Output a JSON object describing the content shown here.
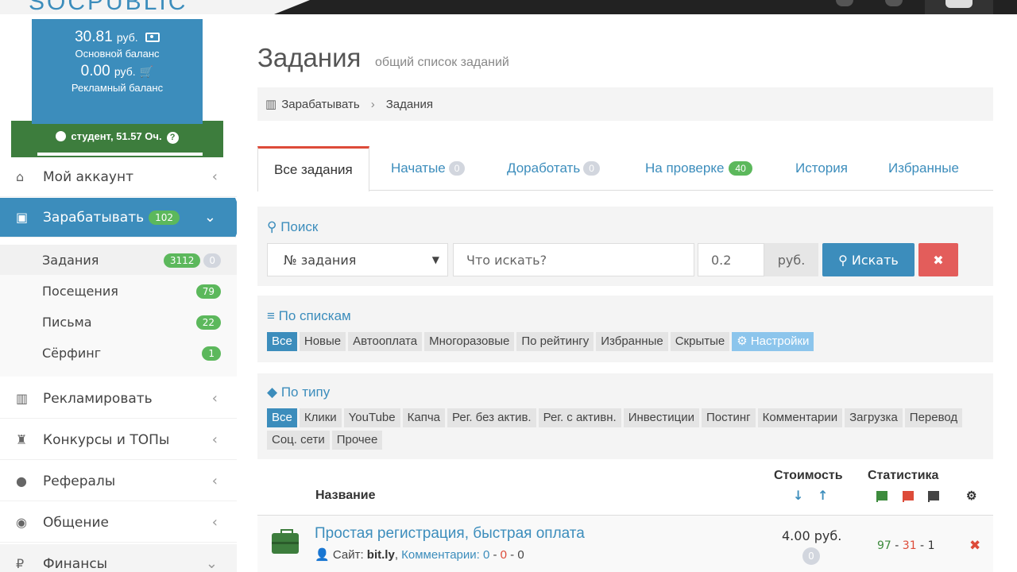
{
  "header": {
    "logo": "SOCPUBLIC"
  },
  "sidebar": {
    "balance_main": "30.81",
    "balance_main_unit": "руб.",
    "balance_main_label": "Основной баланс",
    "balance_ad": "0.00",
    "balance_ad_unit": "руб.",
    "balance_ad_label": "Рекламный баланс",
    "level": "студент, 51.57 Оч.",
    "menu": {
      "account": "Мой аккаунт",
      "earn": "Зарабатывать",
      "earn_badge": "102",
      "advertise": "Рекламировать",
      "contests": "Конкурсы и ТОПы",
      "referrals": "Рефералы",
      "chat": "Общение",
      "finance": "Финансы"
    },
    "submenu": [
      {
        "label": "Задания",
        "badge": "3112",
        "badge2": "0"
      },
      {
        "label": "Посещения",
        "badge": "79"
      },
      {
        "label": "Письма",
        "badge": "22"
      },
      {
        "label": "Сёрфинг",
        "badge": "1"
      }
    ]
  },
  "page": {
    "title": "Задания",
    "subtitle": "общий список заданий"
  },
  "breadcrumb": {
    "root": "Зарабатывать",
    "current": "Задания"
  },
  "tabs": {
    "all": "Все задания",
    "started": "Начатые",
    "started_count": "0",
    "rework": "Доработать",
    "rework_count": "0",
    "review": "На проверке",
    "review_count": "40",
    "history": "История",
    "favorites": "Избранные"
  },
  "search": {
    "title": "Поиск",
    "select_value": "№ задания",
    "placeholder": "Что искать?",
    "price_value": "0.2",
    "price_unit": "руб.",
    "button": "Искать",
    "clear": "✖"
  },
  "lists": {
    "title": "По спискам",
    "chips": [
      "Все",
      "Новые",
      "Автооплата",
      "Многоразовые",
      "По рейтингу",
      "Избранные",
      "Скрытые",
      "Настройки"
    ]
  },
  "types": {
    "title": "По типу",
    "chips": [
      "Все",
      "Клики",
      "YouTube",
      "Капча",
      "Рег. без актив.",
      "Рег. с активн.",
      "Инвестиции",
      "Постинг",
      "Комментарии",
      "Загрузка",
      "Перевод",
      "Соц. сети",
      "Прочее"
    ]
  },
  "table": {
    "col_name": "Название",
    "col_cost": "Стоимость",
    "col_stats": "Статистика",
    "rows": [
      {
        "title": "Простая регистрация, быстрая оплата",
        "site_label": "Сайт:",
        "site": "bit.ly",
        "comments_label": "Комментарии:",
        "c1": "0",
        "c2": "0",
        "c3": "0",
        "price": "4.00 руб.",
        "price_badge": "0",
        "s1": "97",
        "s2": "31",
        "s3": "1"
      }
    ]
  }
}
